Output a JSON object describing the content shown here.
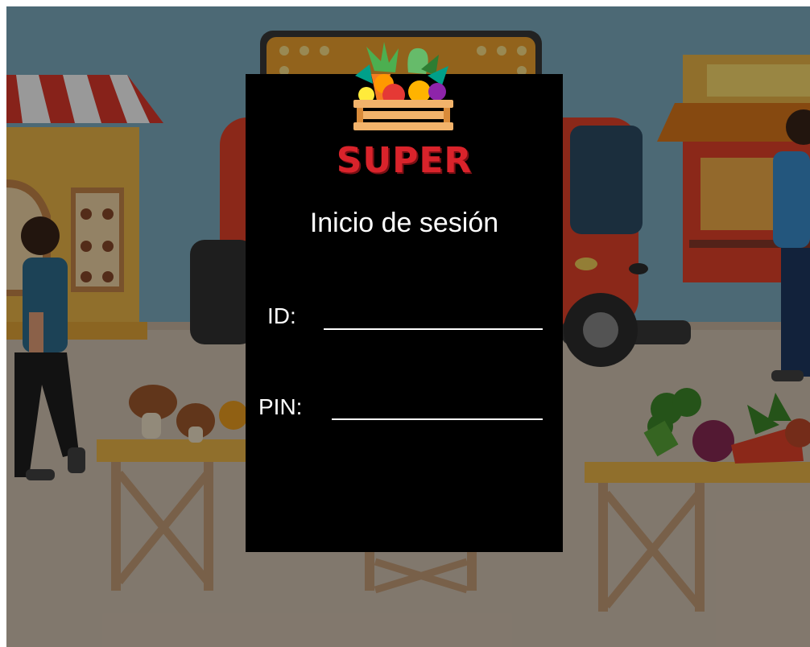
{
  "brand": {
    "name": "SUPER",
    "color": "#d9232b"
  },
  "login": {
    "title": "Inicio de sesión",
    "id_label": "ID:",
    "id_value": "",
    "pin_label": "PIN:",
    "pin_value": ""
  },
  "background": {
    "description_icon": "market-scene"
  },
  "logo": {
    "icon": "vegetable-crate-icon"
  }
}
